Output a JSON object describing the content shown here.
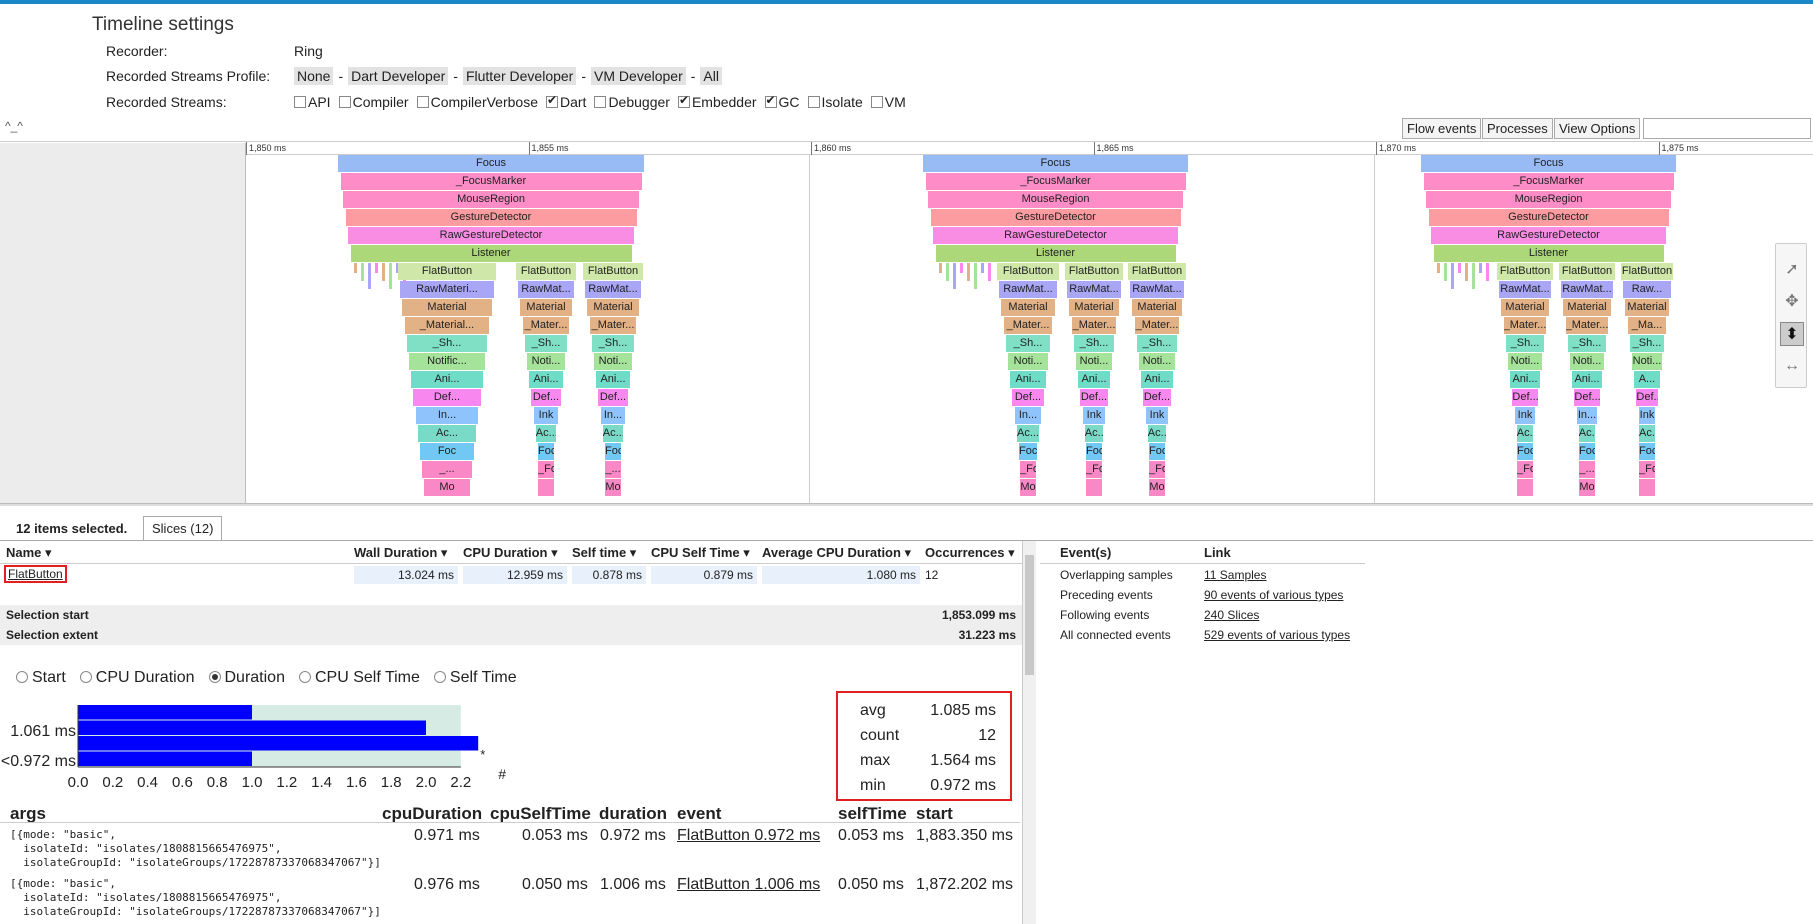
{
  "settings": {
    "title": "Timeline settings",
    "recorder_label": "Recorder:",
    "recorder_value": "Ring",
    "profile_label": "Recorded Streams Profile:",
    "profiles": [
      "None",
      "Dart Developer",
      "Flutter Developer",
      "VM Developer",
      "All"
    ],
    "streams_label": "Recorded Streams:",
    "streams": [
      {
        "name": "API",
        "checked": false
      },
      {
        "name": "Compiler",
        "checked": false
      },
      {
        "name": "CompilerVerbose",
        "checked": false
      },
      {
        "name": "Dart",
        "checked": true
      },
      {
        "name": "Debugger",
        "checked": false
      },
      {
        "name": "Embedder",
        "checked": true
      },
      {
        "name": "GC",
        "checked": true
      },
      {
        "name": "Isolate",
        "checked": false
      },
      {
        "name": "VM",
        "checked": false
      }
    ]
  },
  "toolbar": {
    "caret": "^_^",
    "flow_events": "Flow events",
    "processes": "Processes",
    "view_options": "View Options"
  },
  "ruler": [
    "1,850 ms",
    "1,855 ms",
    "1,860 ms",
    "1,865 ms",
    "1,870 ms",
    "1,875 ms"
  ],
  "flame": {
    "groups": [
      {
        "top": [
          "Focus",
          "_FocusMarker",
          "MouseRegion",
          "GestureDetector",
          "RawGestureDetector",
          "Listener"
        ],
        "cols": [
          [
            "FlatButton",
            "RawMateri...",
            "Material",
            "_Material...",
            "_Sh...",
            "Notific...",
            "Ani...",
            "Def...",
            "In...",
            "Ac...",
            "Foc",
            "_...",
            "Mo"
          ],
          [
            "FlatButton",
            "RawMat...",
            "Material",
            "_Mater...",
            "_Sh...",
            "Noti...",
            "Ani...",
            "Def...",
            "Ink",
            "Ac...",
            "Foc",
            "_Fo",
            ""
          ],
          [
            "FlatButton",
            "RawMat...",
            "Material",
            "_Mater...",
            "_Sh...",
            "Noti...",
            "Ani...",
            "Def...",
            "In...",
            "Ac...",
            "Foc",
            "_...",
            "Mo"
          ]
        ]
      },
      {
        "top": [
          "Focus",
          "_FocusMarker",
          "MouseRegion",
          "GestureDetector",
          "RawGestureDetector",
          "Listener"
        ],
        "cols": [
          [
            "FlatButton",
            "RawMat...",
            "Material",
            "_Mater...",
            "_Sh...",
            "Noti...",
            "Ani...",
            "Def...",
            "In...",
            "Ac...",
            "Foc",
            "_Fo",
            "Mo"
          ],
          [
            "FlatButton",
            "RawMat...",
            "Material",
            "_Mater...",
            "_Sh...",
            "Noti...",
            "Ani...",
            "Def...",
            "Ink",
            "Ac...",
            "Foc",
            "_Fo",
            ""
          ],
          [
            "FlatButton",
            "RawMat...",
            "Material",
            "_Mater...",
            "_Sh...",
            "Noti...",
            "Ani...",
            "Def...",
            "Ink",
            "Ac...",
            "Foc",
            "_Fo",
            "Mo"
          ]
        ]
      },
      {
        "top": [
          "Focus",
          "_FocusMarker",
          "MouseRegion",
          "GestureDetector",
          "RawGestureDetector",
          "Listener"
        ],
        "cols": [
          [
            "FlatButton",
            "RawMat...",
            "Material",
            "_Mater...",
            "_Sh...",
            "Noti...",
            "Ani...",
            "Def...",
            "Ink",
            "Ac...",
            "Foc",
            "_Fo",
            ""
          ],
          [
            "FlatButton",
            "RawMat...",
            "Material",
            "_Mater...",
            "_Sh...",
            "Noti...",
            "Ani...",
            "Def...",
            "In...",
            "Ac...",
            "Foc",
            "_...",
            "Mo"
          ],
          [
            "FlatButton",
            "Raw...",
            "Material",
            "_Ma...",
            "_Sh...",
            "Noti...",
            "A...",
            "Def...",
            "Ink",
            "Ac...",
            "Foc",
            "_Fo",
            ""
          ]
        ]
      }
    ],
    "colors": [
      "#99bbf5",
      "#fd8cc7",
      "#fd8cc7",
      "#fc9ba0",
      "#f98de4",
      "#acd87a",
      "#cfe8a9",
      "#a8a6f5",
      "#e2b186",
      "#e2b186",
      "#7fe0c6",
      "#a5e39a",
      "#6fdcc8",
      "#f888ef",
      "#8ec4fb",
      "#79dbc7",
      "#72c8f4",
      "#fb88c6",
      "#fb88c6"
    ]
  },
  "analysis": {
    "selected_text": "12 items selected.",
    "tab_label": "Slices (12)",
    "columns": [
      "Name",
      "Wall Duration",
      "CPU Duration",
      "Self time",
      "CPU Self Time",
      "Average CPU Duration",
      "Occurrences"
    ],
    "row": {
      "name": "FlatButton",
      "wall": "13.024 ms",
      "cpu": "12.959 ms",
      "self": "0.878 ms",
      "cpu_self": "0.879 ms",
      "avg_cpu": "1.080 ms",
      "occ": "12"
    },
    "selection_start_label": "Selection start",
    "selection_start_value": "1,853.099 ms",
    "selection_extent_label": "Selection extent",
    "selection_extent_value": "31.223 ms",
    "radios": [
      {
        "label": "Start",
        "on": false
      },
      {
        "label": "CPU Duration",
        "on": false
      },
      {
        "label": "Duration",
        "on": true
      },
      {
        "label": "CPU Self Time",
        "on": false
      },
      {
        "label": "Self Time",
        "on": false
      }
    ],
    "histogram": {
      "ylabels": [
        "1.061 ms",
        "<0.972 ms"
      ],
      "xticks": [
        "0.0",
        "0.2",
        "0.4",
        "0.6",
        "0.8",
        "1.0",
        "1.2",
        "1.4",
        "1.6",
        "1.8",
        "2.0",
        "2.2"
      ],
      "hash": "#",
      "star": "*",
      "bars": [
        1.0,
        2.0,
        2.3,
        1.0
      ],
      "bar_color": "#0000ff",
      "bg_color": "#d6ebe3"
    },
    "stats": [
      {
        "k": "avg",
        "v": "1.085 ms"
      },
      {
        "k": "count",
        "v": "12"
      },
      {
        "k": "max",
        "v": "1.564 ms"
      },
      {
        "k": "min",
        "v": "0.972 ms"
      }
    ],
    "bottom_cols": [
      "args",
      "cpuDuration",
      "cpuSelfTime",
      "duration",
      "event",
      "selfTime",
      "start"
    ],
    "bottom_rows": [
      {
        "args": "[{mode: \"basic\",\n  isolateId: \"isolates/1808815665476975\",\n  isolateGroupId: \"isolateGroups/17228787337068347067\"}]",
        "cpuDuration": "0.971 ms",
        "cpuSelfTime": "0.053 ms",
        "duration": "0.972 ms",
        "event": "FlatButton 0.972 ms",
        "selfTime": "0.053 ms",
        "start": "1,883.350 ms"
      },
      {
        "args": "[{mode: \"basic\",\n  isolateId: \"isolates/1808815665476975\",\n  isolateGroupId: \"isolateGroups/17228787337068347067\"}]",
        "cpuDuration": "0.976 ms",
        "cpuSelfTime": "0.050 ms",
        "duration": "1.006 ms",
        "event": "FlatButton 1.006 ms",
        "selfTime": "0.050 ms",
        "start": "1,872.202 ms"
      }
    ],
    "right_cols": [
      "Event(s)",
      "Link"
    ],
    "right_rows": [
      {
        "k": "Overlapping samples",
        "l": "11 Samples"
      },
      {
        "k": "Preceding events",
        "l": "90 events of various types"
      },
      {
        "k": "Following events",
        "l": "240 Slices"
      },
      {
        "k": "All connected events",
        "l": "529 events of various types"
      }
    ]
  }
}
